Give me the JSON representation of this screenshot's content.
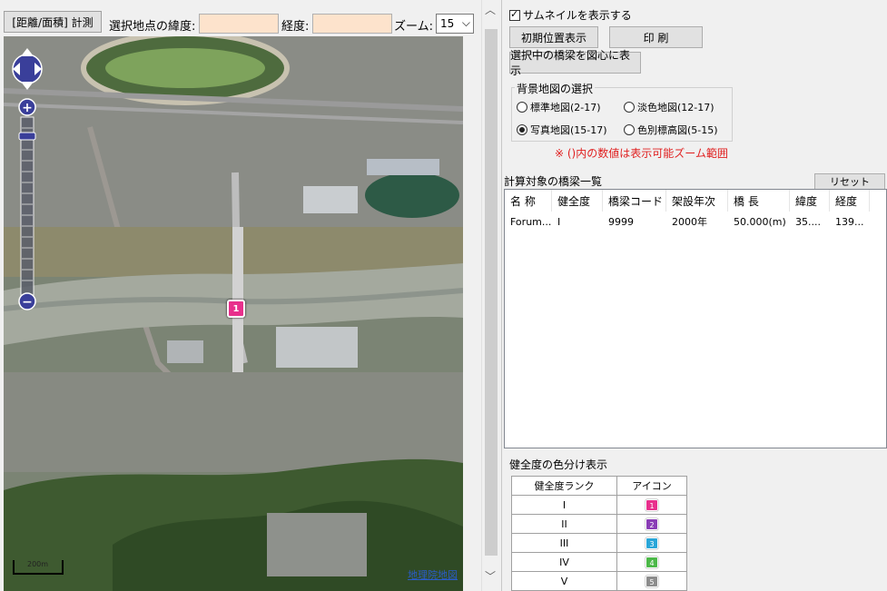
{
  "toolbar": {
    "measure_label": "[距離/面積] 計測",
    "lat_label": "選択地点の緯度:",
    "lat_value": "",
    "lon_label": "経度:",
    "lon_value": "",
    "zoom_label": "ズーム:",
    "zoom_value": "15"
  },
  "map": {
    "scale_label": "200m",
    "copyright": "地理院地図",
    "marker_label": "1"
  },
  "panel": {
    "thumbnail_label": "サムネイルを表示する",
    "thumbnail_checked": true,
    "initial_position_btn": "初期位置表示",
    "print_btn": "印 刷",
    "center_bridge_btn": "選択中の橋梁を図心に表示",
    "bg_title": "背景地図の選択",
    "bg_options": [
      {
        "label": "標準地図(2-17)",
        "selected": false
      },
      {
        "label": "淡色地図(12-17)",
        "selected": false
      },
      {
        "label": "写真地図(15-17)",
        "selected": true
      },
      {
        "label": "色別標高図(5-15)",
        "selected": false
      }
    ],
    "zoom_note": "※ ()内の数値は表示可能ズーム範囲",
    "list_title": "計算対象の橋梁一覧",
    "reset_btn": "リセット",
    "columns": [
      "名 称",
      "健全度",
      "橋梁コード",
      "架設年次",
      "橋 長",
      "緯度",
      "経度"
    ],
    "rows": [
      [
        "Forum...",
        "I",
        "9999",
        "2000年",
        "50.000(m)",
        "35....",
        "139..."
      ]
    ],
    "health_title": "健全度の色分け表示",
    "health_headers": [
      "健全度ランク",
      "アイコン"
    ],
    "health_ranks": [
      {
        "rank": "I",
        "icon": "1",
        "color": "#e8308c"
      },
      {
        "rank": "II",
        "icon": "2",
        "color": "#8a3db6"
      },
      {
        "rank": "III",
        "icon": "3",
        "color": "#2aa6d8"
      },
      {
        "rank": "IV",
        "icon": "4",
        "color": "#4cb848"
      },
      {
        "rank": "V",
        "icon": "5",
        "color": "#8c8c8c"
      }
    ]
  }
}
